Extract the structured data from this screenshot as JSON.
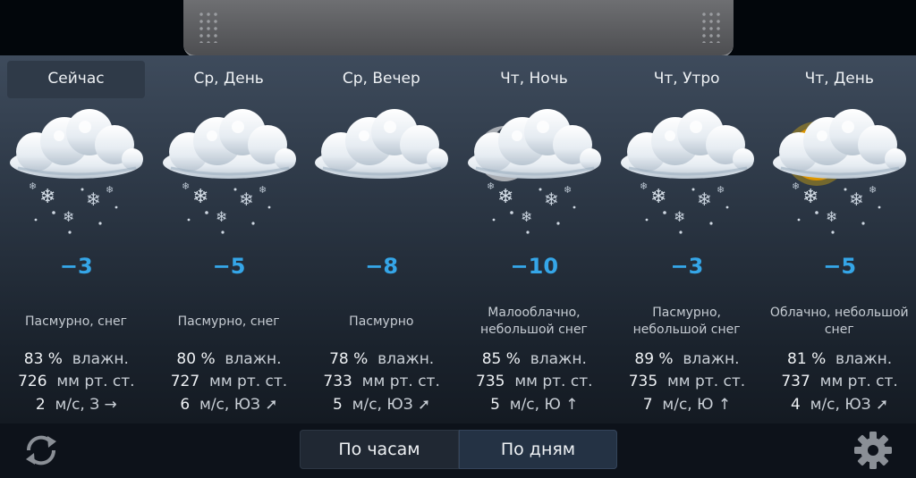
{
  "forecast": [
    {
      "title": "Сейчас",
      "icon": "cloud-snow-icon",
      "temp": "−3",
      "condition": "Пасмурно,  снег",
      "humidity_value": "83 %",
      "humidity_unit": "влажн.",
      "pressure_value": "726",
      "pressure_unit": "мм рт. ст.",
      "wind_value": "2",
      "wind_unit": "м/с, З →"
    },
    {
      "title": "Ср, День",
      "icon": "cloud-snow-icon",
      "temp": "−5",
      "condition": "Пасмурно,  снег",
      "humidity_value": "80 %",
      "humidity_unit": "влажн.",
      "pressure_value": "727",
      "pressure_unit": "мм рт. ст.",
      "wind_value": "6",
      "wind_unit": "м/с, ЮЗ ➚"
    },
    {
      "title": "Ср, Вечер",
      "icon": "cloud-icon",
      "temp": "−8",
      "condition": "Пасмурно",
      "humidity_value": "78 %",
      "humidity_unit": "влажн.",
      "pressure_value": "733",
      "pressure_unit": "мм рт. ст.",
      "wind_value": "5",
      "wind_unit": "м/с, ЮЗ ➚"
    },
    {
      "title": "Чт, Ночь",
      "icon": "moon-cloud-snow-icon",
      "temp": "−10",
      "condition": "Малооблачно, небольшой  снег",
      "humidity_value": "85 %",
      "humidity_unit": "влажн.",
      "pressure_value": "735",
      "pressure_unit": "мм рт. ст.",
      "wind_value": "5",
      "wind_unit": "м/с, Ю ↑"
    },
    {
      "title": "Чт, Утро",
      "icon": "cloud-snow-icon",
      "temp": "−3",
      "condition": "Пасмурно, небольшой  снег",
      "humidity_value": "89 %",
      "humidity_unit": "влажн.",
      "pressure_value": "735",
      "pressure_unit": "мм рт. ст.",
      "wind_value": "7",
      "wind_unit": "м/с, Ю ↑"
    },
    {
      "title": "Чт, День",
      "icon": "sun-cloud-snow-icon",
      "temp": "−5",
      "condition": "Облачно, небольшой снег",
      "humidity_value": "81 %",
      "humidity_unit": "влажн.",
      "pressure_value": "737",
      "pressure_unit": "мм рт. ст.",
      "wind_value": "4",
      "wind_unit": "м/с, ЮЗ ➚"
    }
  ],
  "active_index": 0,
  "bottom": {
    "hours_label": "По часам",
    "days_label": "По дням",
    "selected": "days",
    "refresh_icon": "refresh-icon",
    "settings_icon": "gear-icon"
  },
  "colors": {
    "temperature": "#35a6e8",
    "selected_tab": "#2f3a48"
  }
}
